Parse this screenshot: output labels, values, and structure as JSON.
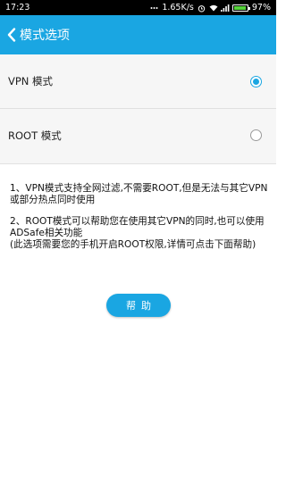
{
  "status_bar": {
    "time": "17:23",
    "net_speed": "1.65K/s",
    "battery_percent": "97%",
    "icons": [
      "more-dots-icon",
      "alarm-icon",
      "wifi-icon",
      "signal-icon",
      "battery-icon"
    ]
  },
  "header": {
    "back_icon": "chevron-left-icon",
    "title": "模式选项"
  },
  "options": [
    {
      "label": "VPN 模式",
      "selected": true
    },
    {
      "label": "ROOT 模式",
      "selected": false
    }
  ],
  "description": {
    "vpn_note": "1、VPN模式支持全网过滤,不需要ROOT,但是无法与其它VPN或部分热点同时使用",
    "root_note_line1": "2、ROOT模式可以帮助您在使用其它VPN的同时,也可以使用ADSafe相关功能",
    "root_note_line2": "(此选项需要您的手机开启ROOT权限,详情可点击下面帮助)"
  },
  "help_button": {
    "label": "帮助"
  },
  "colors": {
    "accent": "#1aa6e2",
    "status_bar_bg": "#000000",
    "options_bg": "#f6f6f6",
    "battery_fill": "#55d23a"
  }
}
